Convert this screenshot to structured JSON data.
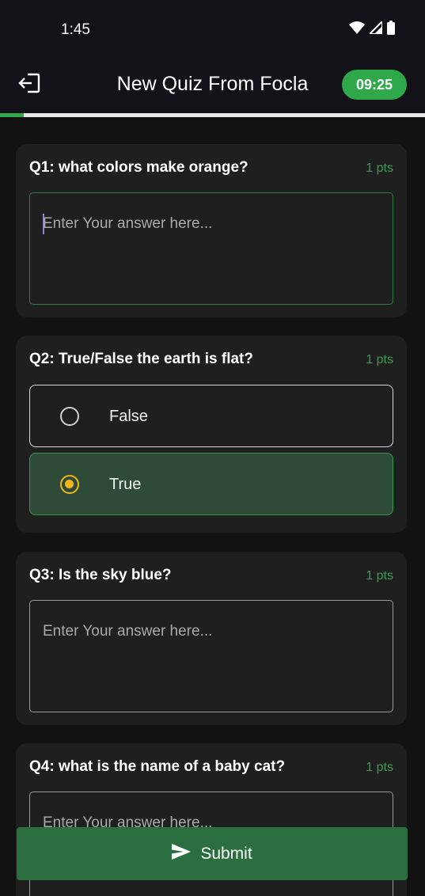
{
  "status_bar": {
    "time": "1:45",
    "icons": [
      "wifi-icon",
      "signal-icon",
      "battery-icon"
    ]
  },
  "app_bar": {
    "exit_icon": "exit-icon",
    "title": "New Quiz From Focla",
    "timer": "09:25"
  },
  "progress": {
    "fraction": 0.055,
    "color": "#2fa84a"
  },
  "questions": [
    {
      "title": "Q1: what colors make orange?",
      "points": "1 pts",
      "type": "text",
      "value": "",
      "placeholder": "Enter Your answer here...",
      "focused": true
    },
    {
      "title": "Q2: True/False the earth is flat?",
      "points": "1 pts",
      "type": "choice",
      "options": [
        {
          "label": "False",
          "selected": false
        },
        {
          "label": "True",
          "selected": true
        }
      ]
    },
    {
      "title": "Q3: Is the sky blue?",
      "points": "1 pts",
      "type": "text",
      "value": "",
      "placeholder": "Enter Your answer here..."
    },
    {
      "title": "Q4: what is the name of a baby cat?",
      "points": "1 pts",
      "type": "text",
      "value": "",
      "placeholder": "Enter Your answer here..."
    }
  ],
  "submit": {
    "label": "Submit",
    "icon": "send-icon"
  },
  "colors": {
    "accent": "#2fa84a",
    "selected_radio": "#f4b41e",
    "selected_option_bg": "#2e4b39",
    "submit_bg": "#2b6e3f"
  }
}
